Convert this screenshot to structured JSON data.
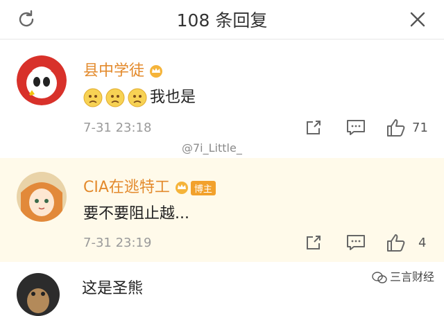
{
  "header": {
    "title": "108 条回复",
    "refresh_icon": "refresh-icon",
    "close_icon": "close-icon"
  },
  "comments": [
    {
      "username": "县中学徒",
      "text": "我也是",
      "emoji": [
        "sad-face-emoji",
        "sad-face-emoji",
        "sad-face-emoji"
      ],
      "time": "7-31 23:18",
      "likes": "71"
    },
    {
      "username": "CIA在逃特工",
      "badge": "博主",
      "text": "要不要阻止越...",
      "time": "7-31 23:19",
      "likes": "4"
    },
    {
      "text": "这是圣熊"
    }
  ],
  "watermarks": {
    "center": "@7i_Little_",
    "corner": "三言财经"
  },
  "colors": {
    "username": "#e38a2c",
    "highlight_bg": "#fffaea",
    "text": "#222222",
    "meta": "#9a9a9a"
  }
}
